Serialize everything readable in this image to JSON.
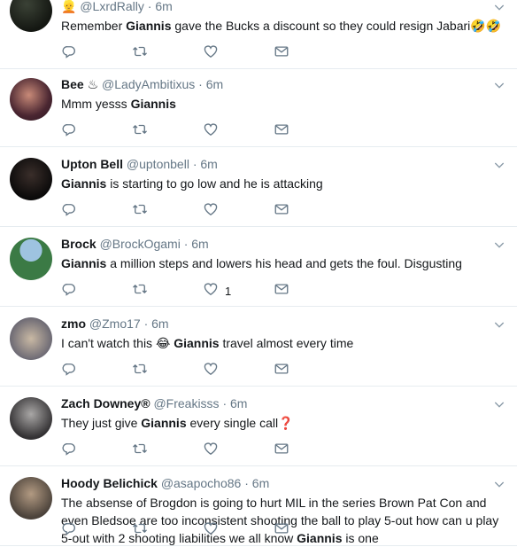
{
  "tweets": [
    {
      "name": "",
      "badge": "👱",
      "handle": "@LxrdRally",
      "time": "6m",
      "text_parts": [
        "Remember ",
        "Giannis",
        " gave the Bucks a discount so they could resign Jabari"
      ],
      "trailing_emoji": "🤣🤣",
      "likes": ""
    },
    {
      "name": "Bee",
      "badge": "♨",
      "handle": "@LadyAmbitixus",
      "time": "6m",
      "text_parts": [
        "Mmm yesss ",
        "Giannis",
        ""
      ],
      "trailing_emoji": "",
      "likes": ""
    },
    {
      "name": "Upton Bell",
      "badge": "",
      "handle": "@uptonbell",
      "time": "6m",
      "text_parts": [
        "",
        "Giannis",
        " is starting to go low and he is attacking"
      ],
      "trailing_emoji": "",
      "likes": ""
    },
    {
      "name": "Brock",
      "badge": "",
      "handle": "@BrockOgami",
      "time": "6m",
      "text_parts": [
        "",
        "Giannis",
        " a million steps and lowers his head and gets the foul. Disgusting"
      ],
      "trailing_emoji": "",
      "likes": "1"
    },
    {
      "name": "zmo",
      "badge": "",
      "handle": "@Zmo17",
      "time": "6m",
      "text_parts": [
        "I can't watch this 😂 ",
        "Giannis",
        " travel almost every time"
      ],
      "trailing_emoji": "",
      "likes": ""
    },
    {
      "name": "Zach Downey®",
      "badge": "",
      "handle": "@Freakisss",
      "time": "6m",
      "text_parts": [
        "They just give ",
        "Giannis",
        " every single call"
      ],
      "trailing_emoji": "❓",
      "likes": ""
    },
    {
      "name": "Hoody Belichick",
      "badge": "",
      "handle": "@asapocho86",
      "time": "6m",
      "text_parts": [
        "The absense of Brogdon is going to hurt MIL in the series Brown Pat Con and even Bledsoe are too inconsistent shooting the ball to play 5-out how can u play 5-out with 2 shooting liabilities we all know ",
        "Giannis",
        " is one"
      ],
      "trailing_emoji": "",
      "likes": ""
    }
  ],
  "icons": {
    "reply": "reply-icon",
    "retweet": "retweet-icon",
    "like": "heart-icon",
    "dm": "envelope-icon",
    "caret": "chevron-down-icon"
  },
  "colors": {
    "text": "#14171a",
    "muted": "#657786",
    "divider": "#e6ecf0",
    "caret": "#8899a6"
  }
}
